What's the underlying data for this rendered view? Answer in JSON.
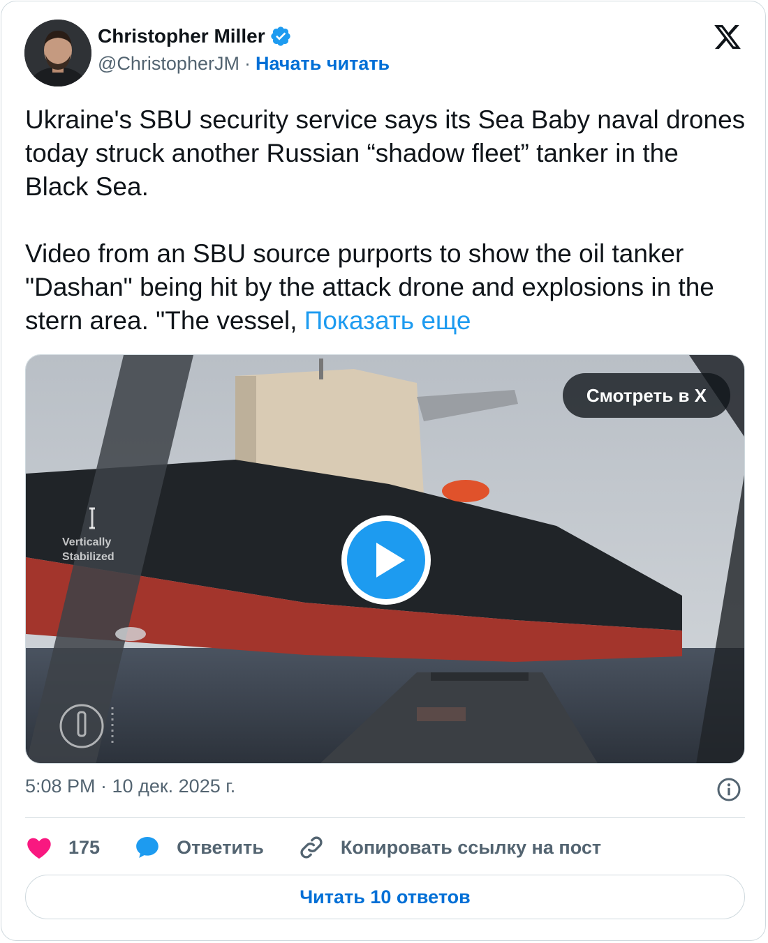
{
  "author": {
    "name": "Christopher Miller",
    "handle": "@ChristopherJM",
    "separator": "·",
    "follow_label": "Начать читать"
  },
  "tweet": {
    "paragraph1": "Ukraine's SBU security service says its Sea Baby naval drones today struck another Russian “shadow fleet” tanker in the Black Sea.",
    "paragraph2": "Video from an SBU source purports to show the oil tanker \"Dashan\" being hit by the attack drone and explosions in the stern area. \"The vessel, ",
    "show_more": "Показать еще"
  },
  "media": {
    "watch_label": "Смотреть в X",
    "overlay_label_line1": "Vertically",
    "overlay_label_line2": "Stabilized"
  },
  "meta": {
    "timestamp": "5:08 PM · 10 дек. 2025 г."
  },
  "actions": {
    "likes": "175",
    "reply_label": "Ответить",
    "copy_label": "Копировать ссылку на пост"
  },
  "read_replies_label": "Читать 10 ответов",
  "colors": {
    "link": "#1d9bf0",
    "follow": "#006fd6",
    "like": "#f91880",
    "reply": "#1d9bf0",
    "muted": "#536471"
  },
  "icons": [
    "verified-badge-icon",
    "x-logo-icon",
    "play-icon",
    "info-icon",
    "heart-icon",
    "reply-bubble-icon",
    "link-icon"
  ]
}
